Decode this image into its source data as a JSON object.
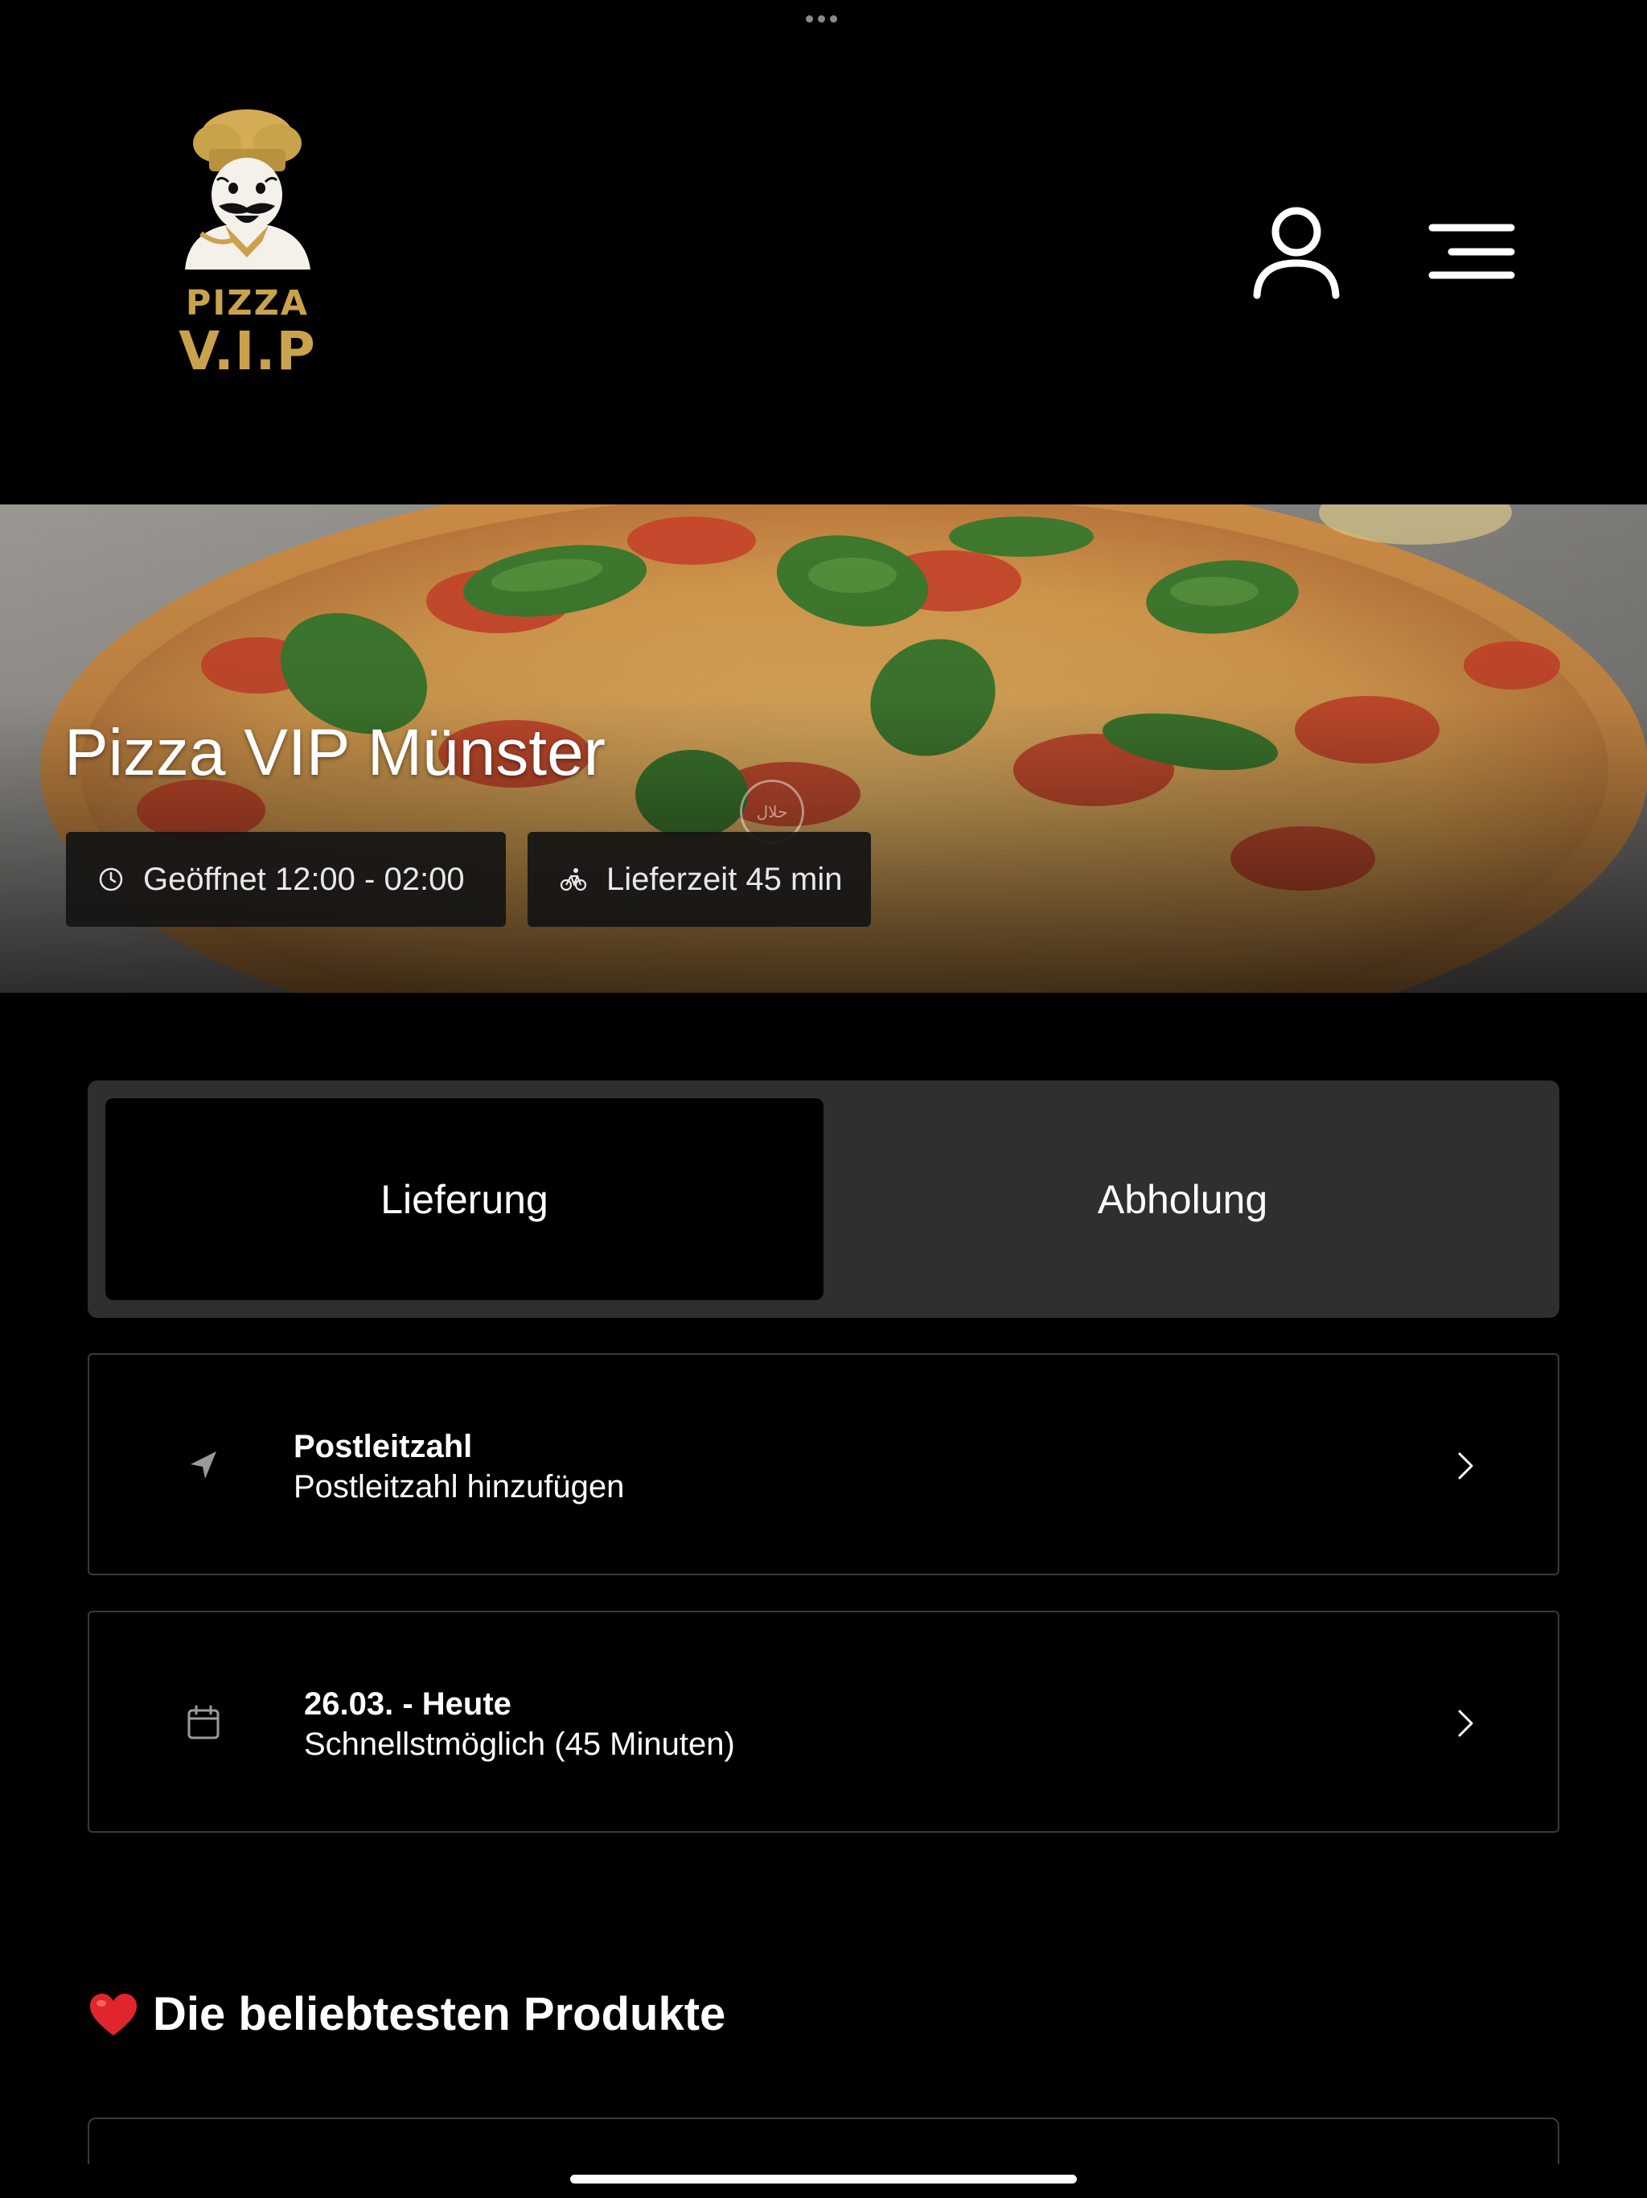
{
  "header": {
    "logo_line1": "PIZZA",
    "logo_line2": "V.I.P",
    "account_icon": "user-icon",
    "menu_icon": "hamburger-menu-icon"
  },
  "hero": {
    "title": "Pizza VIP Münster",
    "opening_hours": "Geöffnet 12:00 - 02:00",
    "delivery_time": "Lieferzeit 45 min",
    "opening_icon": "clock-icon",
    "delivery_icon": "bicycle-icon"
  },
  "order_mode": {
    "options": [
      "Lieferung",
      "Abholung"
    ],
    "selected": "Lieferung"
  },
  "zip_card": {
    "title": "Postleitzahl",
    "subtitle": "Postleitzahl hinzufügen",
    "icon": "location-arrow-icon"
  },
  "date_card": {
    "title": "26.03. - Heute",
    "subtitle": "Schnellstmöglich (45 Minuten)",
    "icon": "calendar-icon"
  },
  "popular": {
    "title": "Die beliebtesten Produkte",
    "icon": "heart-icon"
  },
  "colors": {
    "background": "#000000",
    "accent_gold": "#c9a24c",
    "segment_bg": "#2f2f2f",
    "card_border": "#3a3a3a"
  }
}
